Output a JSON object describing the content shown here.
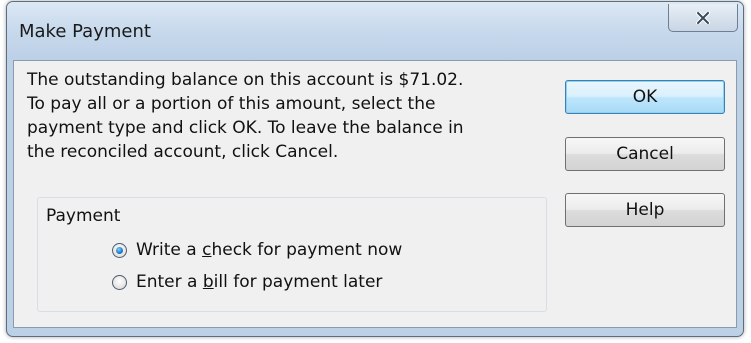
{
  "window": {
    "title": "Make Payment",
    "close_icon": "close-icon"
  },
  "message": {
    "lines": [
      "The outstanding balance on this account is $71.02.",
      "To pay all or a portion of this amount,  select the",
      "payment type and click OK.  To leave the balance in",
      "the reconciled account, click Cancel."
    ]
  },
  "buttons": {
    "ok": "OK",
    "cancel": "Cancel",
    "help": "Help"
  },
  "payment": {
    "group_label": "Payment",
    "options": [
      {
        "pre": "Write a ",
        "mnemonic": "c",
        "post": "heck for payment now",
        "checked": true
      },
      {
        "pre": "Enter a ",
        "mnemonic": "b",
        "post": "ill for payment later",
        "checked": false
      }
    ]
  }
}
